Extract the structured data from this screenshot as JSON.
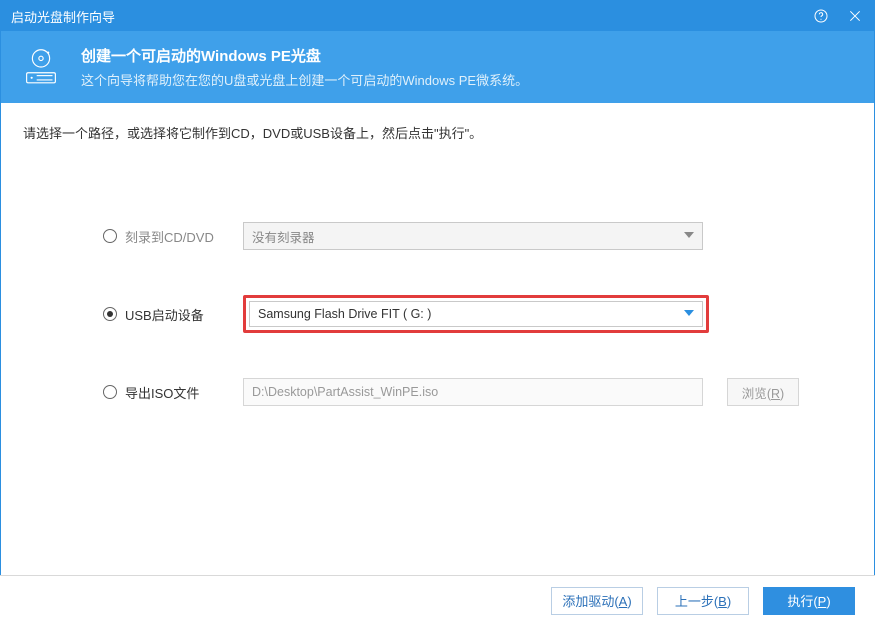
{
  "title_bar": {
    "text": "启动光盘制作向导"
  },
  "header": {
    "title": "创建一个可启动的Windows PE光盘",
    "subtitle": "这个向导将帮助您在您的U盘或光盘上创建一个可启动的Windows PE微系统。"
  },
  "instruction": "请选择一个路径，或选择将它制作到CD，DVD或USB设备上，然后点击\"执行\"。",
  "options": {
    "cd": {
      "label": "刻录到CD/DVD",
      "value": "没有刻录器",
      "selected": false,
      "disabled": true
    },
    "usb": {
      "label": "USB启动设备",
      "value": "Samsung Flash Drive FIT ( G: )",
      "selected": true
    },
    "iso": {
      "label": "导出ISO文件",
      "value": "D:\\Desktop\\PartAssist_WinPE.iso",
      "selected": false,
      "browse_label": "浏览",
      "browse_key": "R"
    }
  },
  "footer": {
    "add_driver": {
      "label": "添加驱动",
      "key": "A"
    },
    "back": {
      "label": "上一步",
      "key": "B"
    },
    "execute": {
      "label": "执行",
      "key": "P"
    }
  }
}
